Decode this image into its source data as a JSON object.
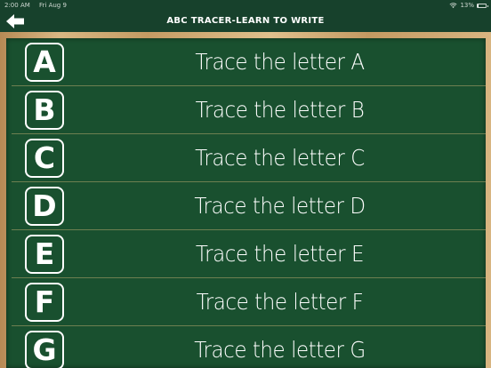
{
  "status_bar": {
    "time": "2:00 AM",
    "date": "Fri Aug 9",
    "battery": "13%"
  },
  "header": {
    "title": "ABC TRACER-LEARN TO WRITE",
    "back_icon": "arrow-left-icon"
  },
  "list": {
    "items": [
      {
        "letter": "A",
        "label": "Trace the letter A"
      },
      {
        "letter": "B",
        "label": "Trace the letter B"
      },
      {
        "letter": "C",
        "label": "Trace the letter C"
      },
      {
        "letter": "D",
        "label": "Trace the letter D"
      },
      {
        "letter": "E",
        "label": "Trace the letter E"
      },
      {
        "letter": "F",
        "label": "Trace the letter F"
      },
      {
        "letter": "G",
        "label": "Trace the letter G"
      }
    ]
  },
  "colors": {
    "board": "#19502f",
    "frame": "#c8a06a",
    "header": "#17412c",
    "text": "#ffffff"
  }
}
